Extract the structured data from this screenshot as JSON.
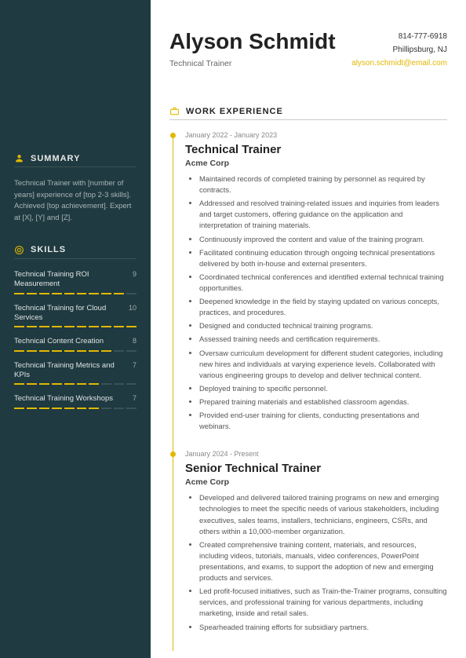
{
  "name": "Alyson Schmidt",
  "title": "Technical Trainer",
  "contact": {
    "phone": "814-777-6918",
    "location": "Phillipsburg, NJ",
    "email": "alyson.schmidt@email.com"
  },
  "sections": {
    "summary": "SUMMARY",
    "skills": "SKILLS",
    "work": "WORK EXPERIENCE"
  },
  "summary_text": "Technical Trainer with [number of years] experience of [top 2-3 skills]. Achieved [top achievement]. Expert at [X], [Y] and [Z].",
  "skills": [
    {
      "name": "Technical Training ROI Measurement",
      "rating": 9
    },
    {
      "name": "Technical Training for Cloud Services",
      "rating": 10
    },
    {
      "name": "Technical Content Creation",
      "rating": 8
    },
    {
      "name": "Technical Training Metrics and KPIs",
      "rating": 7
    },
    {
      "name": "Technical Training Workshops",
      "rating": 7
    }
  ],
  "jobs": [
    {
      "dates": "January 2022 - January 2023",
      "title": "Technical Trainer",
      "company": "Acme Corp",
      "bullets": [
        "Maintained records of completed training by personnel as required by contracts.",
        "Addressed and resolved training-related issues and inquiries from leaders and target customers, offering guidance on the application and interpretation of training materials.",
        "Continuously improved the content and value of the training program.",
        "Facilitated continuing education through ongoing technical presentations delivered by both in-house and external presenters.",
        "Coordinated technical conferences and identified external technical training opportunities.",
        "Deepened knowledge in the field by staying updated on various concepts, practices, and procedures.",
        "Designed and conducted technical training programs.",
        "Assessed training needs and certification requirements.",
        "Oversaw curriculum development for different student categories, including new hires and individuals at varying experience levels. Collaborated with various engineering groups to develop and deliver technical content.",
        "Deployed training to specific personnel.",
        "Prepared training materials and established classroom agendas.",
        "Provided end-user training for clients, conducting presentations and webinars."
      ]
    },
    {
      "dates": "January 2024 - Present",
      "title": "Senior Technical Trainer",
      "company": "Acme Corp",
      "bullets": [
        "Developed and delivered tailored training programs on new and emerging technologies to meet the specific needs of various stakeholders, including executives, sales teams, installers, technicians, engineers, CSRs, and others within a 10,000-member organization.",
        "Created comprehensive training content, materials, and resources, including videos, tutorials, manuals, video conferences, PowerPoint presentations, and exams, to support the adoption of new and emerging products and services.",
        "Led profit-focused initiatives, such as Train-the-Trainer programs, consulting services, and professional training for various departments, including marketing, inside and retail sales.",
        "Spearheaded training efforts for subsidiary partners."
      ]
    }
  ]
}
